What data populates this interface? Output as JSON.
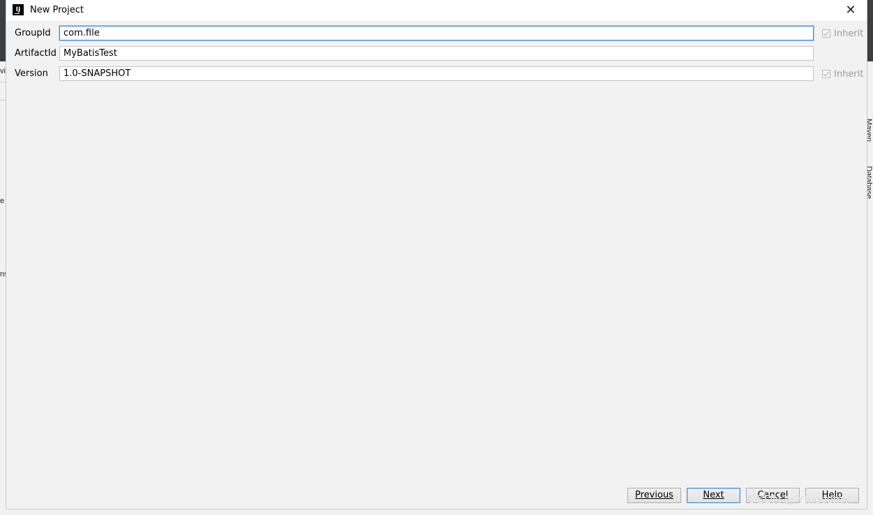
{
  "background": {
    "left_fragments": [
      "vi",
      "e",
      "ns"
    ],
    "right_tools": [
      "Maven",
      "Database"
    ]
  },
  "dialog": {
    "title": "New Project",
    "icon": "intellij-idea-icon",
    "close_icon": "close-icon"
  },
  "form": {
    "group_id": {
      "label": "GroupId",
      "value": "com.file",
      "inherit_label": "Inherit",
      "inherit_checked": true
    },
    "artifact_id": {
      "label": "ArtifactId",
      "value": "MyBatisTest"
    },
    "version": {
      "label": "Version",
      "value": "1.0-SNAPSHOT",
      "inherit_label": "Inherit",
      "inherit_checked": true
    }
  },
  "buttons": {
    "previous": "Previous",
    "next": "Next",
    "cancel": "Cancel",
    "help": "Help"
  },
  "watermark": "CSDN @YmovomY",
  "colors": {
    "focus_border": "#3c8bd9",
    "dialog_bg": "#f2f2f2"
  }
}
